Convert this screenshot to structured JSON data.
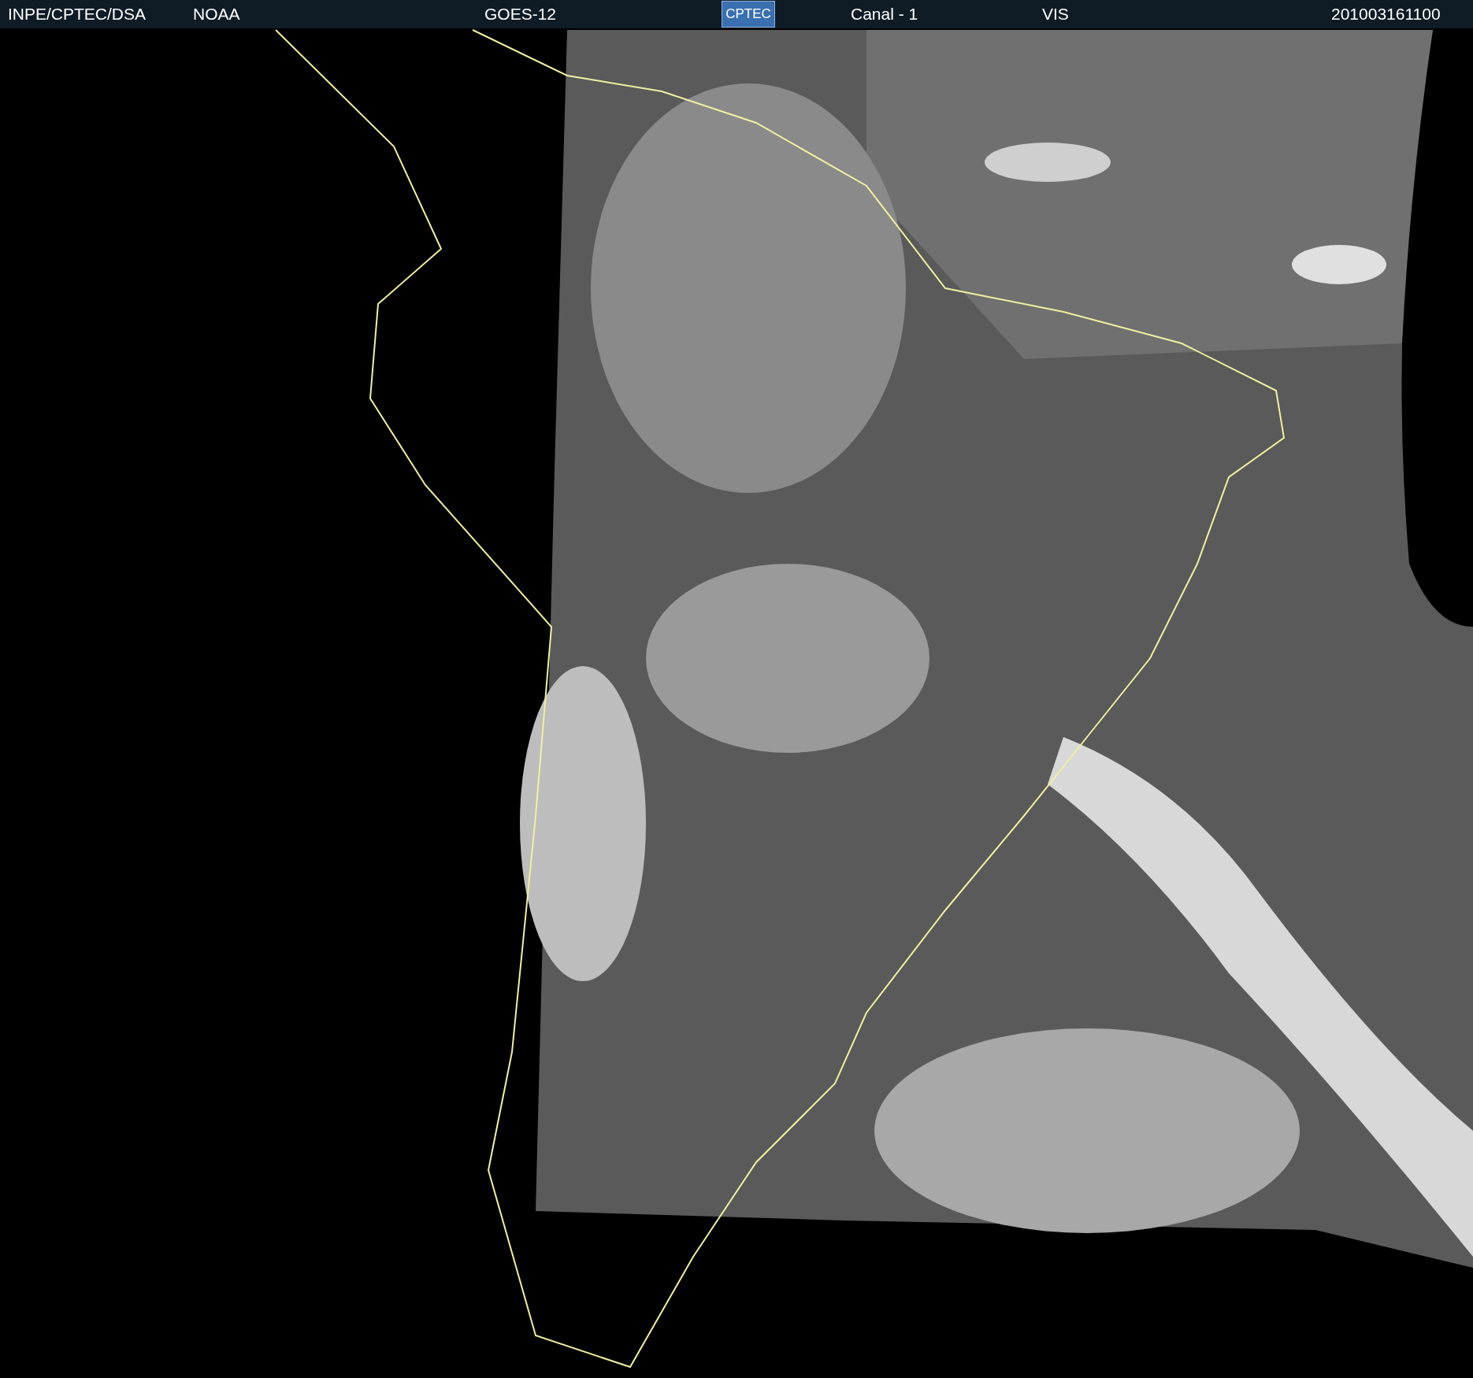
{
  "header": {
    "items": [
      {
        "kind": "text",
        "text": "INPE/CPTEC/DSA"
      },
      {
        "kind": "text",
        "text": "NOAA"
      },
      {
        "kind": "text",
        "text": "GOES-12"
      },
      {
        "kind": "logo",
        "text": "CPTEC"
      },
      {
        "kind": "text",
        "text": "Canal - 1"
      },
      {
        "kind": "text",
        "text": "VIS"
      },
      {
        "kind": "text",
        "text": "201003161100"
      }
    ]
  }
}
